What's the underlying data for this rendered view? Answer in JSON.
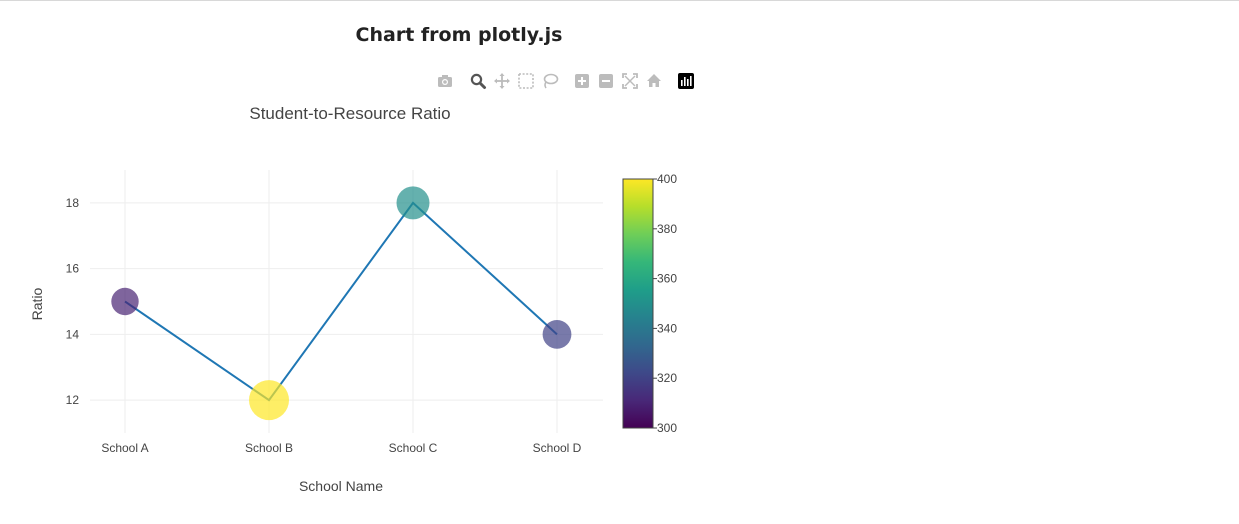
{
  "page_title": "Chart from plotly.js",
  "modebar": {
    "icons": [
      "camera-icon",
      "zoom-icon",
      "pan-icon",
      "box-select-icon",
      "lasso-select-icon",
      "zoom-in-icon",
      "zoom-out-icon",
      "autoscale-icon",
      "reset-axes-icon",
      "plotly-logo-icon"
    ],
    "active": "zoom-icon"
  },
  "chart_data": {
    "type": "line",
    "mode": "lines+markers",
    "title": "Student-to-Resource Ratio",
    "xlabel": "School Name",
    "ylabel": "Ratio",
    "categories": [
      "School A",
      "School B",
      "School C",
      "School D"
    ],
    "series": [
      {
        "values": [
          15,
          12,
          18,
          14
        ],
        "line_color": "#1f77b4",
        "marker_color_values": [
          310,
          400,
          350,
          320
        ],
        "marker_opacity": 0.7
      }
    ],
    "ylim": [
      11,
      19
    ],
    "yticks": [
      12,
      14,
      16,
      18
    ],
    "grid": true,
    "legend": false,
    "colorbar": {
      "colorscale": "Viridis",
      "range": [
        300,
        400
      ],
      "ticks": [
        300,
        320,
        340,
        360,
        380,
        400
      ]
    }
  }
}
